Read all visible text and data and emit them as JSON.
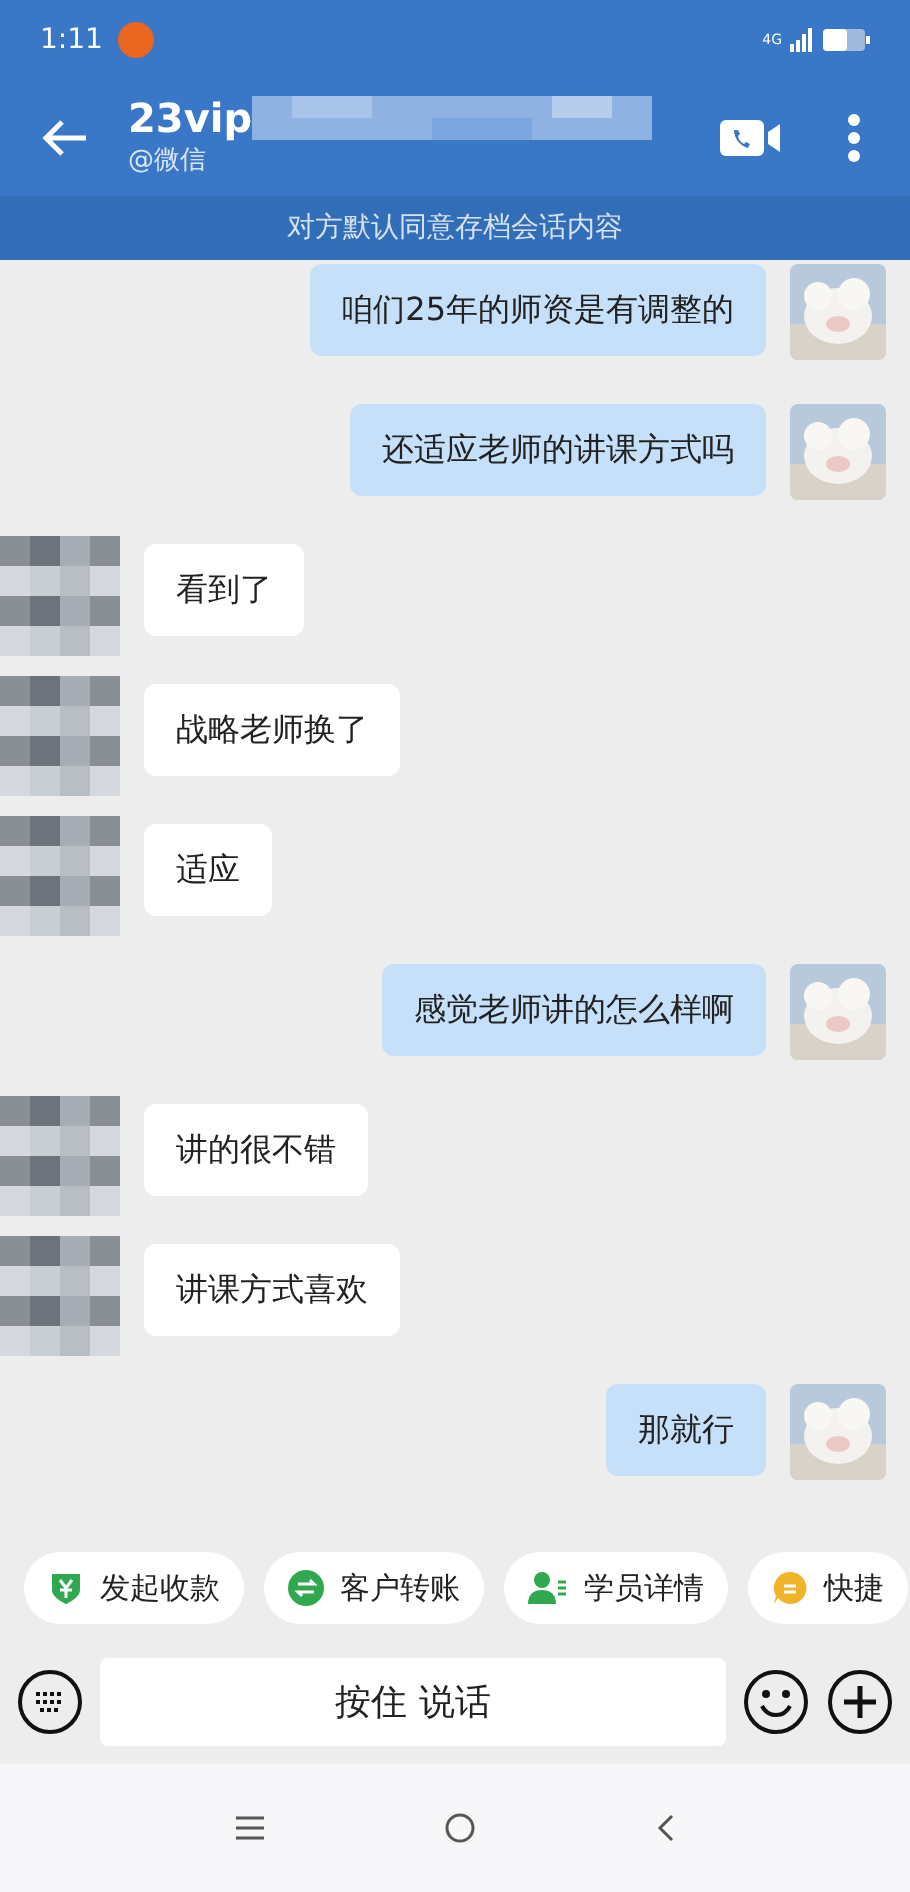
{
  "status_bar": {
    "time": "1:11",
    "network": "4G"
  },
  "header": {
    "title": "23vip",
    "subtitle": "@微信"
  },
  "banner": "对方默认同意存档会话内容",
  "messages": [
    {
      "kind": "sent",
      "text": "咱们25年的师资是有调整的"
    },
    {
      "kind": "sent",
      "text": "还适应老师的讲课方式吗"
    },
    {
      "kind": "received",
      "text": "看到了"
    },
    {
      "kind": "received",
      "text": "战略老师换了"
    },
    {
      "kind": "received",
      "text": "适应"
    },
    {
      "kind": "sent",
      "text": "感觉老师讲的怎么样啊"
    },
    {
      "kind": "received",
      "text": "讲的很不错"
    },
    {
      "kind": "received",
      "text": "讲课方式喜欢"
    },
    {
      "kind": "sent",
      "text": "那就行"
    }
  ],
  "quick_actions": [
    {
      "label": "发起收款",
      "kind": "payment",
      "color": "#2fa84f"
    },
    {
      "label": "客户转账",
      "kind": "transfer",
      "color": "#2fa84f"
    },
    {
      "label": "学员详情",
      "kind": "student",
      "color": "#2fa84f"
    },
    {
      "label": "快捷",
      "kind": "quick",
      "color": "#f0b429"
    }
  ],
  "input": {
    "label": "按住 说话"
  }
}
